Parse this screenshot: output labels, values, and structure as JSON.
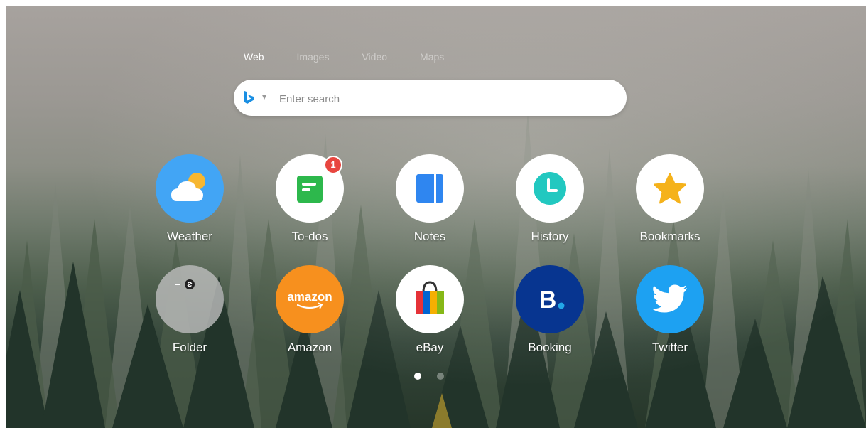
{
  "search": {
    "tabs": [
      {
        "label": "Web",
        "active": true
      },
      {
        "label": "Images",
        "active": false
      },
      {
        "label": "Video",
        "active": false
      },
      {
        "label": "Maps",
        "active": false
      }
    ],
    "engine_icon": "bing-icon",
    "placeholder": "Enter search",
    "value": ""
  },
  "tiles": [
    {
      "label": "Weather",
      "icon": "weather-cloud-sun-icon"
    },
    {
      "label": "To-dos",
      "icon": "todo-note-icon",
      "badge": "1"
    },
    {
      "label": "Notes",
      "icon": "notes-book-icon"
    },
    {
      "label": "History",
      "icon": "clock-icon"
    },
    {
      "label": "Bookmarks",
      "icon": "star-icon"
    },
    {
      "label": "Folder",
      "icon": "folder-icon"
    },
    {
      "label": "Amazon",
      "icon": "amazon-logo-icon",
      "logo_text": "amazon"
    },
    {
      "label": "eBay",
      "icon": "ebay-bag-icon"
    },
    {
      "label": "Booking",
      "icon": "booking-logo-icon",
      "logo_text": "B"
    },
    {
      "label": "Twitter",
      "icon": "twitter-bird-icon"
    }
  ],
  "pagination": {
    "pages": 2,
    "current": 1
  },
  "colors": {
    "weather": "#42a5f5",
    "todo": "#2db84c",
    "notes": "#2f86f0",
    "history": "#22c8c0",
    "bookmark": "#f5b21b",
    "amazon": "#f7901e",
    "booking": "#073590",
    "booking_dot": "#22a7e8",
    "twitter": "#1da1f2",
    "badge": "#e8463f"
  }
}
